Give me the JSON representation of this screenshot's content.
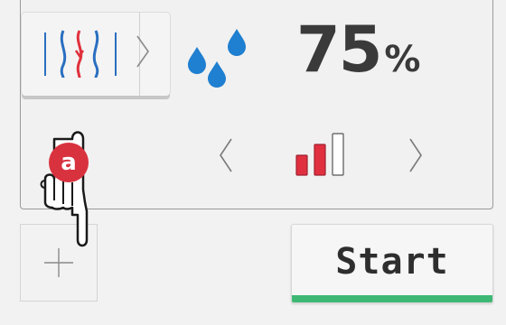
{
  "humidity": {
    "value": "75",
    "unit": "%"
  },
  "start_button": {
    "label": "Start"
  },
  "gesture": {
    "badge_label": "a"
  },
  "level": {
    "active_bars": 2,
    "total_bars": 3
  },
  "colors": {
    "water_drop": "#1f7fd0",
    "level_bar_active": "#e03040",
    "start_accent": "#3db874",
    "gesture_badge": "#d9323f",
    "mode_icon_blue": "#2a6fc0",
    "mode_icon_red": "#e0303c"
  },
  "icons": {
    "mode": "airflow-mode-icon",
    "mode_next": "chevron-right-icon",
    "humidity": "water-drops-icon",
    "level_prev": "chevron-left-icon",
    "level_next": "chevron-right-icon",
    "level": "signal-bars-icon",
    "add": "plus-icon",
    "gesture": "hand-pointer-icon"
  }
}
